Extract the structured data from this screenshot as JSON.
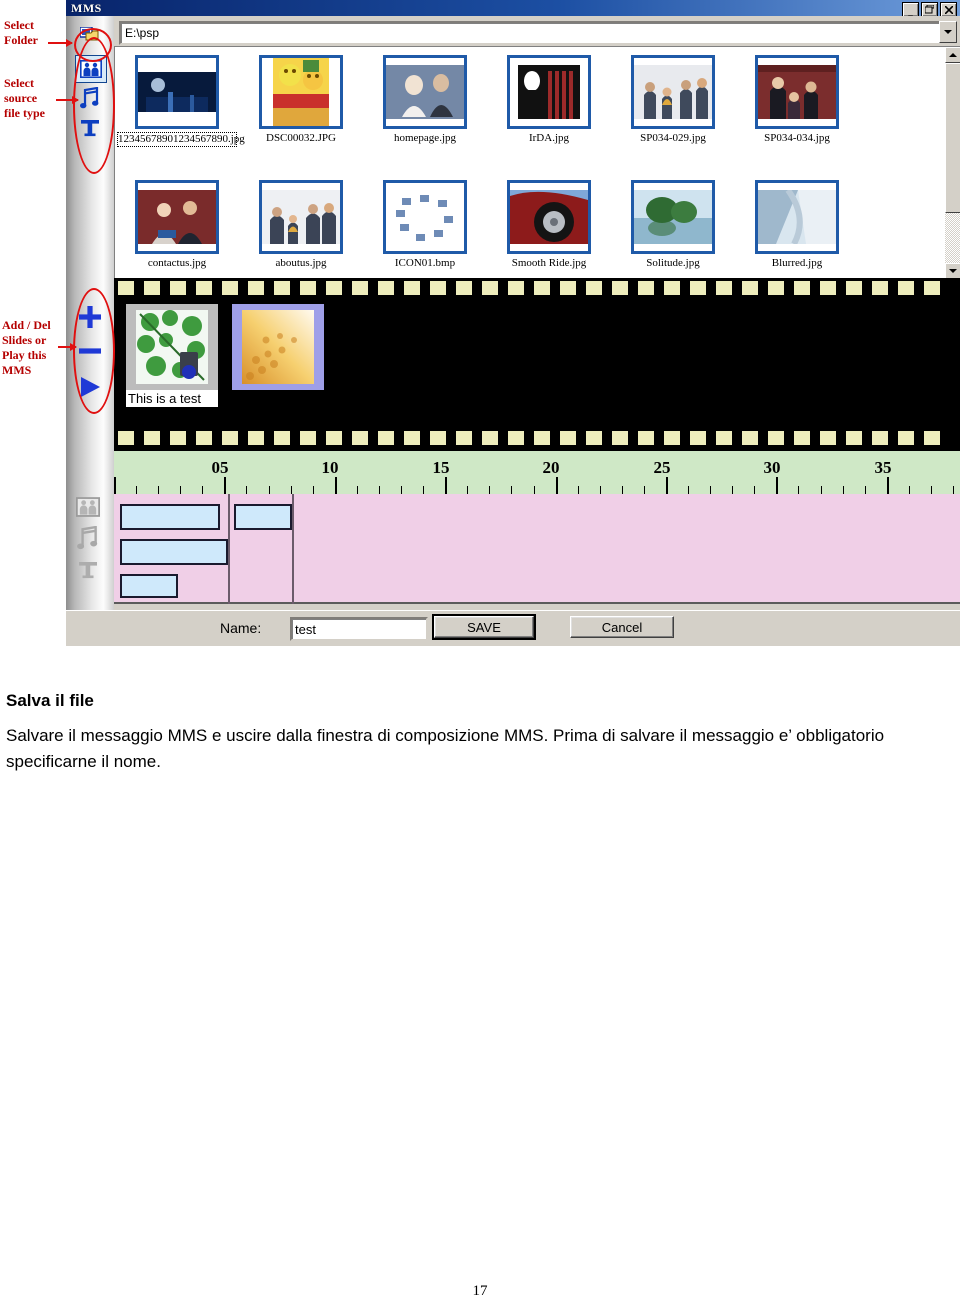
{
  "window": {
    "title": "MMS",
    "buttons": {
      "minimize": "_",
      "restore": "❐",
      "close": "✕"
    }
  },
  "path_bar": {
    "value": "E:\\psp",
    "dropdown_icon": "chevron-down-icon"
  },
  "side_toolbar": {
    "items": [
      {
        "name": "select-folder",
        "icon": "folder-icon",
        "selected": false
      },
      {
        "name": "source-image",
        "icon": "image-people-icon",
        "selected": true
      },
      {
        "name": "source-audio",
        "icon": "music-note-icon",
        "selected": false
      },
      {
        "name": "source-text",
        "icon": "text-t-icon",
        "selected": false
      },
      {
        "name": "add-slide",
        "icon": "plus-icon",
        "selected": false
      },
      {
        "name": "delete-slide",
        "icon": "minus-icon",
        "selected": false
      },
      {
        "name": "play-mms",
        "icon": "play-triangle-icon",
        "selected": false
      }
    ]
  },
  "annotations": [
    {
      "id": "select-folder",
      "lines": [
        "Select",
        "Folder"
      ]
    },
    {
      "id": "select-source",
      "lines": [
        "Select",
        "source",
        "file type"
      ]
    },
    {
      "id": "add-del",
      "lines": [
        "Add / Del",
        "Slides or",
        "Play this",
        "MMS"
      ]
    }
  ],
  "browser": {
    "row1": [
      {
        "label": "12345678901234567890.jpg",
        "selected": true
      },
      {
        "label": "DSC00032.JPG",
        "selected": false
      },
      {
        "label": "homepage.jpg",
        "selected": false
      },
      {
        "label": "IrDA.jpg",
        "selected": false
      },
      {
        "label": "SP034-029.jpg",
        "selected": false
      },
      {
        "label": "SP034-034.jpg",
        "selected": false
      }
    ],
    "row2": [
      {
        "label": "contactus.jpg",
        "selected": false
      },
      {
        "label": "aboutus.jpg",
        "selected": false
      },
      {
        "label": "ICON01.bmp",
        "selected": false
      },
      {
        "label": "Smooth Ride.jpg",
        "selected": false
      },
      {
        "label": "Solitude.jpg",
        "selected": false
      },
      {
        "label": "Blurred.jpg",
        "selected": false
      }
    ],
    "scrollbar": {
      "up_icon": "caret-up-icon",
      "down_icon": "caret-down-icon"
    }
  },
  "filmstrip": {
    "slides": [
      {
        "caption": "This is a test",
        "selected": true
      },
      {
        "caption": "",
        "selected": false
      }
    ]
  },
  "timeline": {
    "ruler_labels": [
      "05",
      "10",
      "15",
      "20",
      "25",
      "30",
      "35"
    ],
    "track_icons": [
      "image-people-icon",
      "music-note-icon",
      "text-t-icon"
    ],
    "clips": [
      {
        "track": "image",
        "start": 0.3,
        "end": 4.5
      },
      {
        "track": "image",
        "start": 5.2,
        "end": 7.6
      },
      {
        "track": "audio",
        "start": 0.3,
        "end": 5.0
      },
      {
        "track": "text",
        "start": 0.3,
        "end": 2.3
      }
    ]
  },
  "bottom_bar": {
    "name_label": "Name:",
    "name_value": "test",
    "save_label": "SAVE",
    "cancel_label": "Cancel"
  },
  "document": {
    "heading": "Salva il file",
    "body": "Salvare il messaggio MMS e uscire dalla finestra di composizione MMS. Prima di salvare il messaggio e’ obbligatorio specificarne il nome.",
    "page_number": "17"
  }
}
